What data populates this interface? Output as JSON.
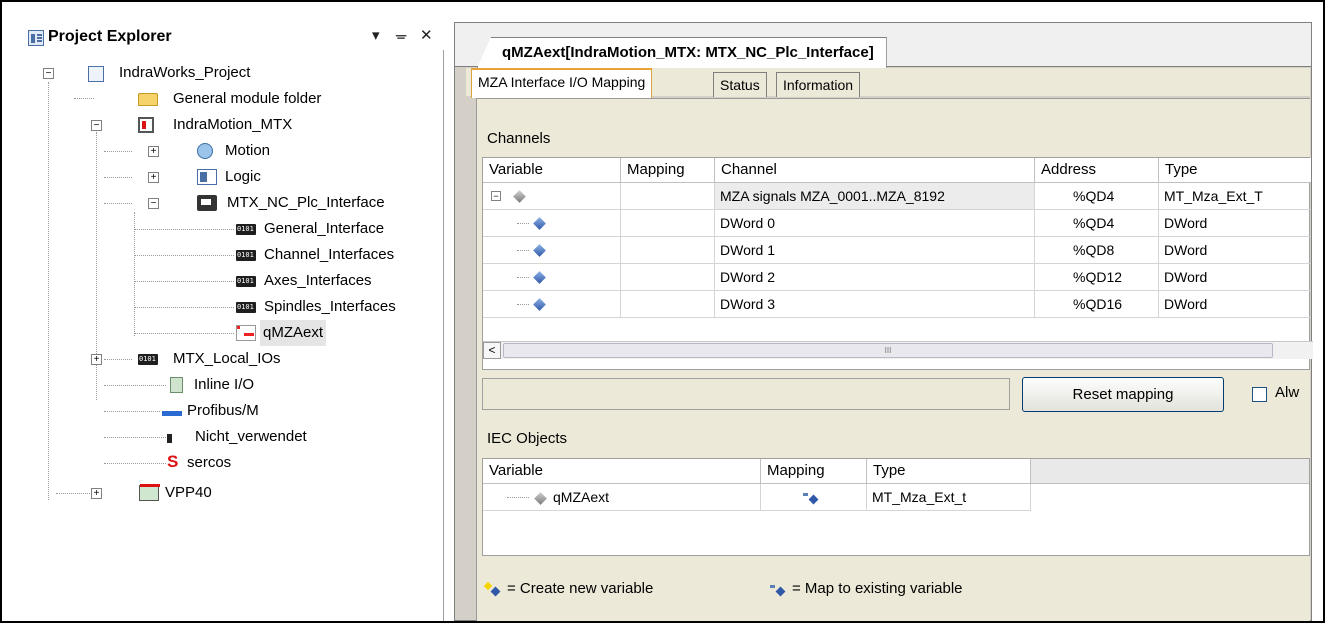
{
  "explorer": {
    "title": "Project Explorer",
    "controls": {
      "dropdown": "▾",
      "pin": "ᚚ",
      "close": "✕"
    },
    "tree": [
      {
        "label": "IndraWorks_Project",
        "icon": "project-icon",
        "expander": "−"
      },
      {
        "label": "General module folder",
        "icon": "folder-icon"
      },
      {
        "label": "IndraMotion_MTX",
        "icon": "mtx-icon",
        "expander": "−"
      },
      {
        "label": "Motion",
        "icon": "motion-icon",
        "expander": "+"
      },
      {
        "label": "Logic",
        "icon": "logic-icon",
        "expander": "+"
      },
      {
        "label": "MTX_NC_Plc_Interface",
        "icon": "plc-interface-icon",
        "expander": "−"
      },
      {
        "label": "General_Interface",
        "icon": "io-icon"
      },
      {
        "label": "Channel_Interfaces",
        "icon": "io-icon"
      },
      {
        "label": "Axes_Interfaces",
        "icon": "io-icon"
      },
      {
        "label": "Spindles_Interfaces",
        "icon": "io-icon"
      },
      {
        "label": "qMZAext",
        "icon": "qmza-icon"
      },
      {
        "label": "MTX_Local_IOs",
        "icon": "io-icon",
        "expander": "+"
      },
      {
        "label": "Inline I/O",
        "icon": "inline-io-icon"
      },
      {
        "label": "Profibus/M",
        "icon": "profibus-icon"
      },
      {
        "label": "Nicht_verwendet",
        "icon": "nicht-icon"
      },
      {
        "label": "sercos",
        "icon": "sercos-icon",
        "glyph": "S"
      },
      {
        "label": "VPP40",
        "icon": "vpp-icon",
        "expander": "+"
      }
    ]
  },
  "editor": {
    "doc_tab": "qMZAext[IndraMotion_MTX: MTX_NC_Plc_Interface]",
    "sub_tabs": [
      "MZA Interface I/O Mapping",
      "Status",
      "Information"
    ],
    "channels": {
      "label": "Channels",
      "headers": [
        "Variable",
        "Mapping",
        "Channel",
        "Address",
        "Type"
      ],
      "rows": [
        {
          "expander": "−",
          "channel": "MZA signals MZA_0001..MZA_8192",
          "address": "%QD4",
          "type": "MT_Mza_Ext_T"
        },
        {
          "channel": "DWord 0",
          "address": "%QD4",
          "type": "DWord"
        },
        {
          "channel": "DWord 1",
          "address": "%QD8",
          "type": "DWord"
        },
        {
          "channel": "DWord 2",
          "address": "%QD12",
          "type": "DWord"
        },
        {
          "channel": "DWord 3",
          "address": "%QD16",
          "type": "DWord"
        }
      ],
      "scroll_left": "<",
      "scroll_grip": "III"
    },
    "reset_label": "Reset mapping",
    "always_label": "Alw",
    "iec": {
      "label": "IEC Objects",
      "headers": [
        "Variable",
        "Mapping",
        "Type"
      ],
      "rows": [
        {
          "variable": "qMZAext",
          "type": "MT_Mza_Ext_t"
        }
      ]
    },
    "legend": {
      "create": "= Create new variable",
      "map": "= Map to existing variable"
    }
  },
  "colors": {
    "active_tab_accent": "#e8a33b",
    "selection": "#e5e5e5"
  }
}
